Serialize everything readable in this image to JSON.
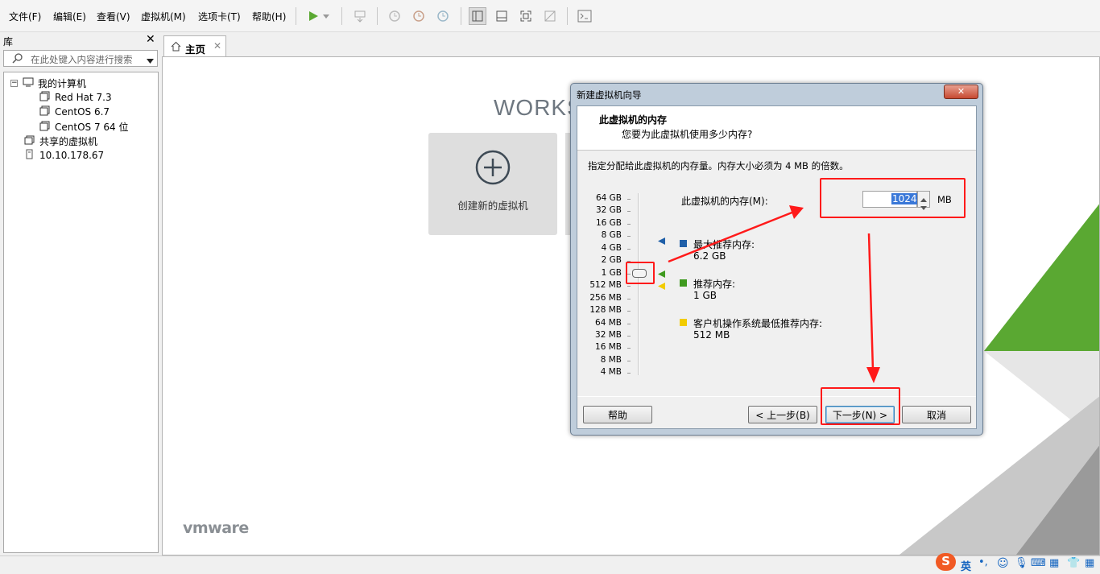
{
  "menu": {
    "file": "文件(F)",
    "edit": "编辑(E)",
    "view": "查看(V)",
    "vm": "虚拟机(M)",
    "tabs": "选项卡(T)",
    "help": "帮助(H)"
  },
  "library": {
    "title": "库",
    "search_placeholder": "在此处键入内容进行搜索",
    "tree": {
      "root": "我的计算机",
      "vms": [
        "Red Hat 7.3",
        "CentOS 6.7",
        "CentOS 7 64 位"
      ],
      "shared": "共享的虚拟机",
      "host": "10.10.178.67"
    }
  },
  "tab": {
    "home_label": "主页"
  },
  "home": {
    "brand_partial": "WORKS",
    "create_vm_label": "创建新的虚拟机",
    "vmware_logo": "vmware"
  },
  "dialog": {
    "title": "新建虚拟机向导",
    "header_title": "此虚拟机的内存",
    "header_subtitle": "您要为此虚拟机使用多少内存?",
    "instruction": "指定分配给此虚拟机的内存量。内存大小必须为 4 MB 的倍数。",
    "memory_label": "此虚拟机的内存(M):",
    "memory_value": "1024",
    "memory_unit": "MB",
    "scale": [
      "64 GB",
      "32 GB",
      "16 GB",
      "8 GB",
      "4 GB",
      "2 GB",
      "1 GB",
      "512 MB",
      "256 MB",
      "128 MB",
      "64 MB",
      "32 MB",
      "16 MB",
      "8 MB",
      "4 MB"
    ],
    "legend": {
      "max_label": "最大推荐内存:",
      "max_value": "6.2 GB",
      "max_color": "#1f5fa8",
      "rec_label": "推荐内存:",
      "rec_value": "1 GB",
      "rec_color": "#3f9a1f",
      "min_label": "客户机操作系统最低推荐内存:",
      "min_value": "512 MB",
      "min_color": "#f2cc00"
    },
    "buttons": {
      "help": "帮助",
      "back": "< 上一步(B)",
      "next": "下一步(N) >",
      "cancel": "取消"
    }
  },
  "taskbar": {
    "ime_label": "英"
  }
}
